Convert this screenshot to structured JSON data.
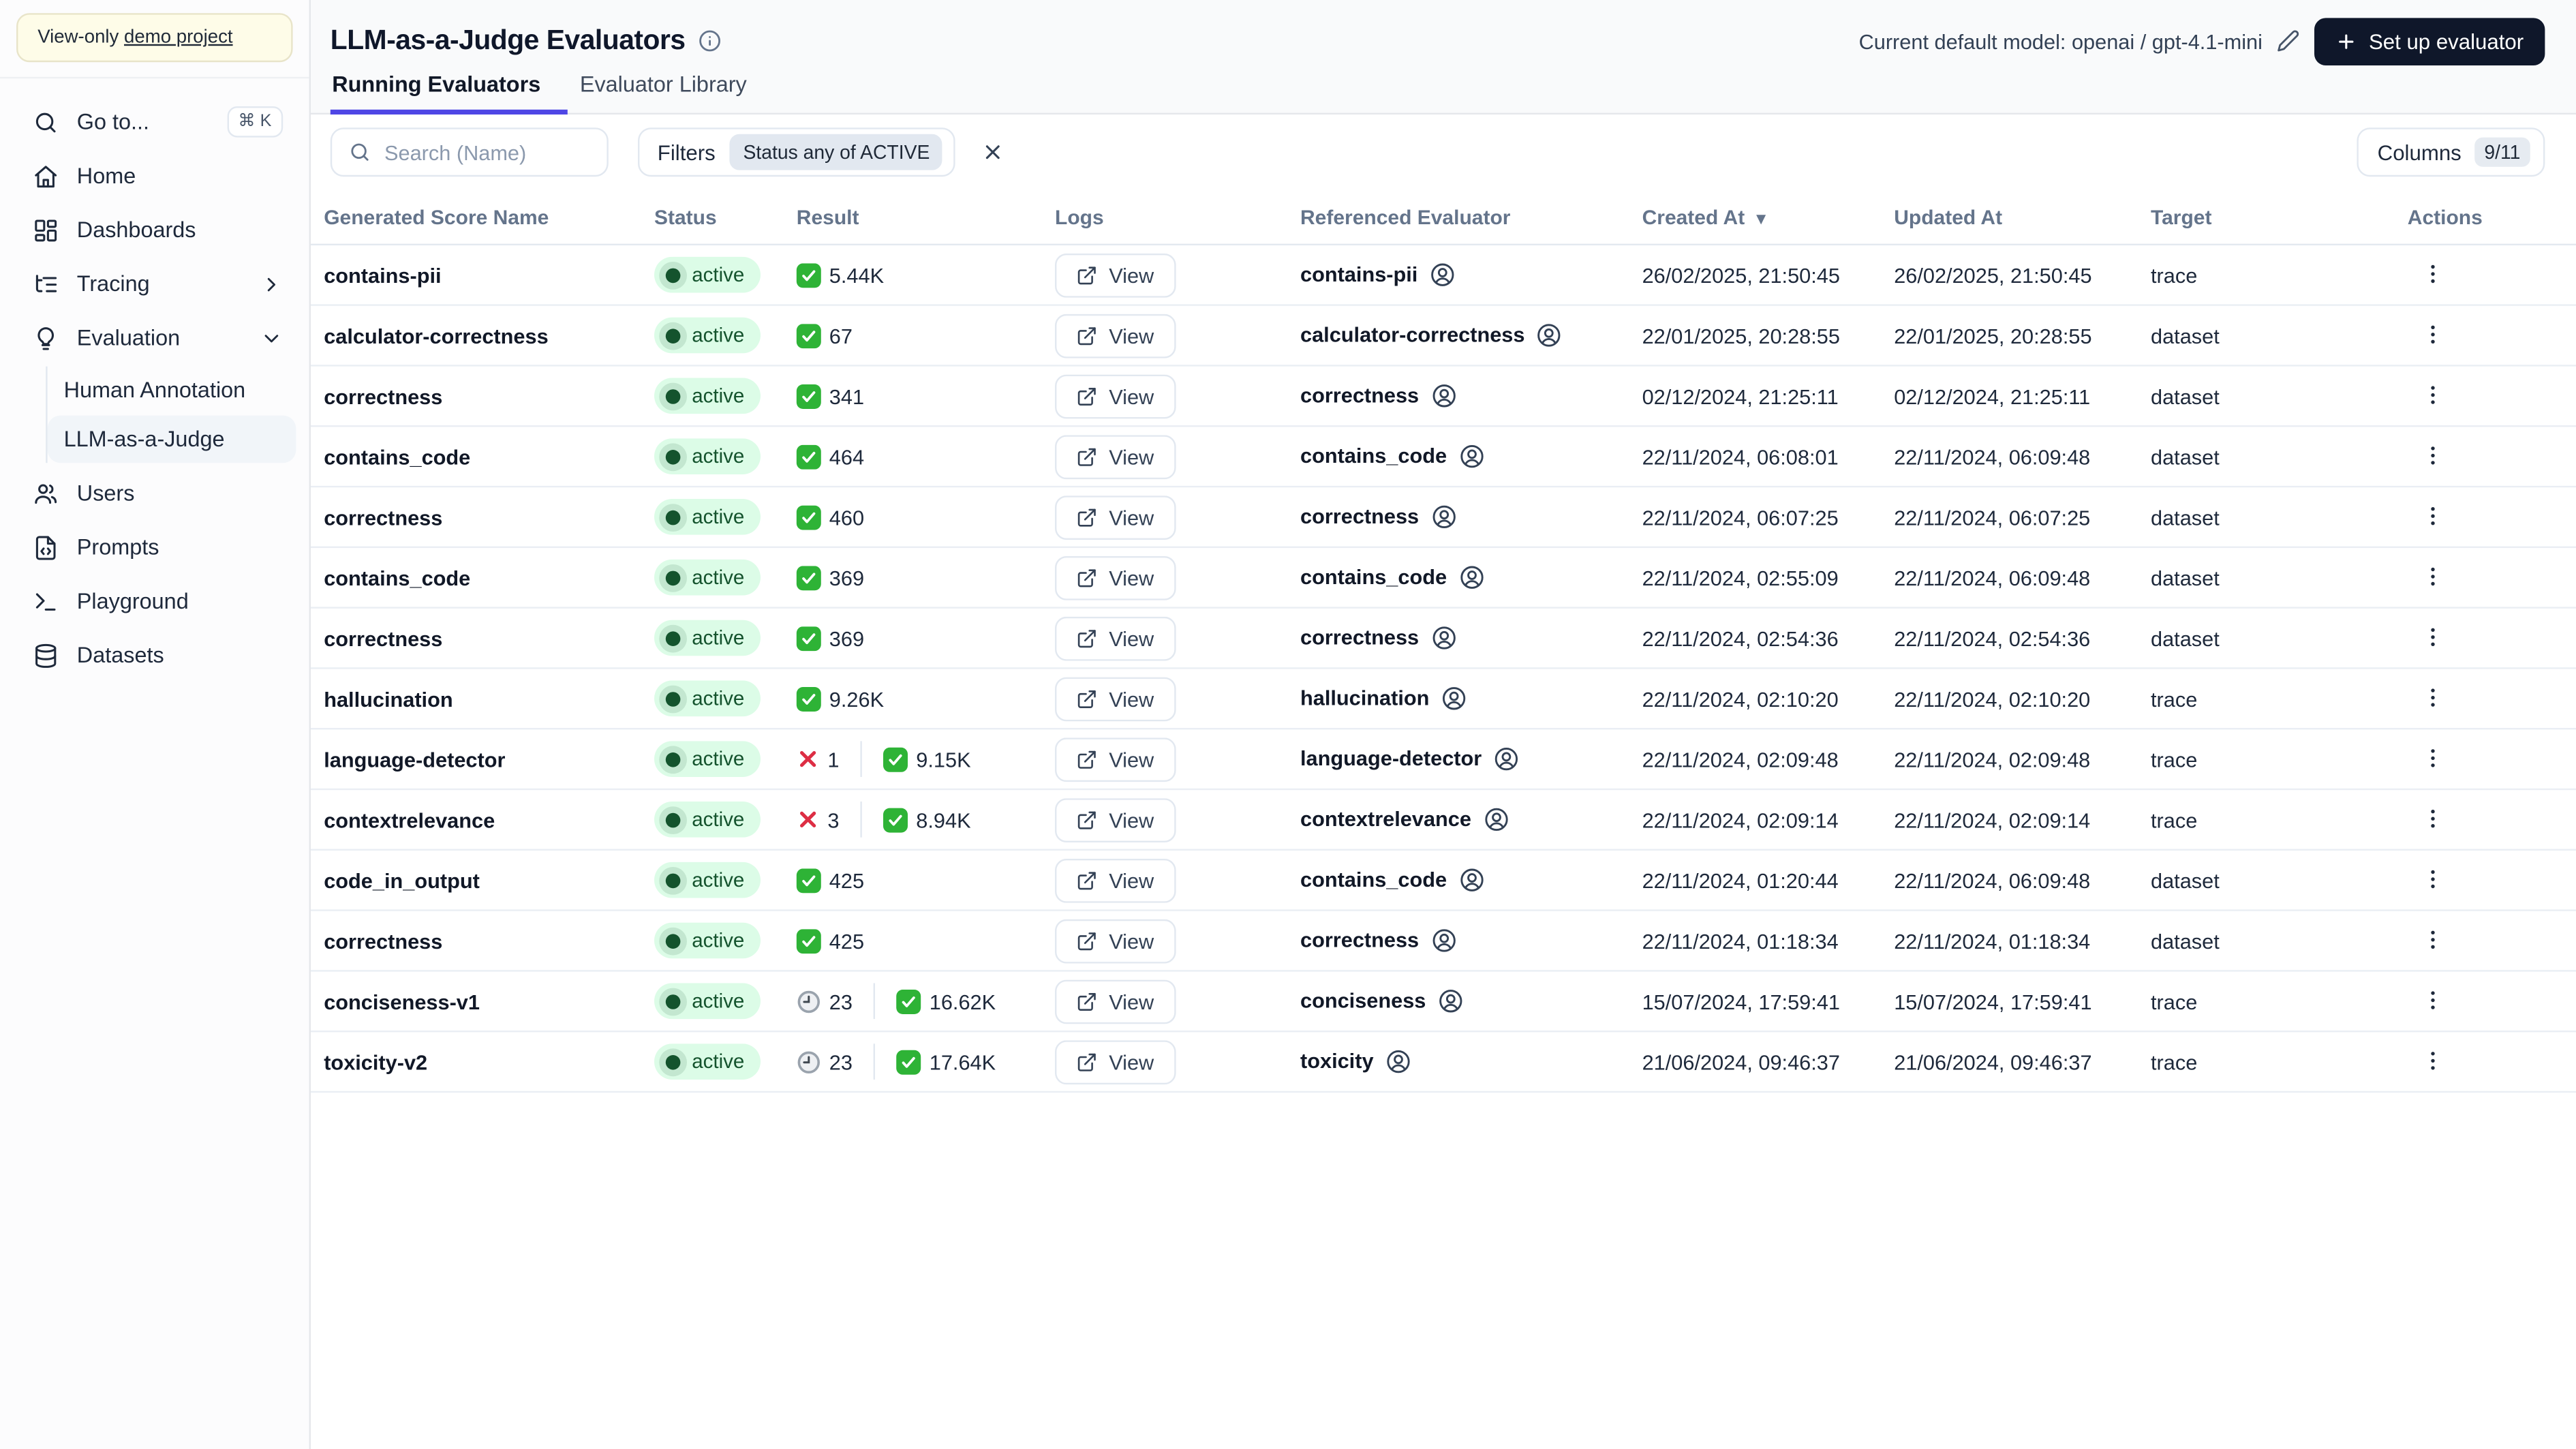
{
  "sidebar": {
    "banner_prefix": "View-only ",
    "banner_link": "demo project",
    "goto": {
      "label": "Go to...",
      "shortcut": "⌘ K"
    },
    "nav": [
      {
        "label": "Home",
        "icon": "home-icon"
      },
      {
        "label": "Dashboards",
        "icon": "dashboards-icon"
      },
      {
        "label": "Tracing",
        "icon": "tracing-icon",
        "chevron": "right"
      },
      {
        "label": "Evaluation",
        "icon": "evaluation-icon",
        "chevron": "down",
        "children": [
          {
            "label": "Human Annotation",
            "active": false
          },
          {
            "label": "LLM-as-a-Judge",
            "active": true
          }
        ]
      },
      {
        "label": "Users",
        "icon": "users-icon"
      },
      {
        "label": "Prompts",
        "icon": "prompts-icon"
      },
      {
        "label": "Playground",
        "icon": "playground-icon"
      },
      {
        "label": "Datasets",
        "icon": "datasets-icon"
      }
    ]
  },
  "header": {
    "title": "LLM-as-a-Judge Evaluators",
    "model_label": "Current default model: openai / gpt-4.1-mini",
    "setup_button": "Set up evaluator"
  },
  "tabs": [
    {
      "label": "Running Evaluators",
      "active": true
    },
    {
      "label": "Evaluator Library",
      "active": false
    }
  ],
  "toolbar": {
    "search_placeholder": "Search (Name)",
    "filters_label": "Filters",
    "filter_chip": "Status any of ACTIVE",
    "columns_label": "Columns",
    "columns_count": "9/11"
  },
  "table": {
    "columns": [
      "Generated Score Name",
      "Status",
      "Result",
      "Logs",
      "Referenced Evaluator",
      "Created At",
      "Updated At",
      "Target",
      "Actions"
    ],
    "sort": {
      "column": "Created At",
      "direction": "desc"
    },
    "logs_label": "View",
    "rows": [
      {
        "name": "contains-pii",
        "status": "active",
        "result": {
          "success": "5.44K"
        },
        "evaluator": "contains-pii",
        "created": "26/02/2025, 21:50:45",
        "updated": "26/02/2025, 21:50:45",
        "target": "trace"
      },
      {
        "name": "calculator-correctness",
        "status": "active",
        "result": {
          "success": "67"
        },
        "evaluator": "calculator-correctness",
        "created": "22/01/2025, 20:28:55",
        "updated": "22/01/2025, 20:28:55",
        "target": "dataset"
      },
      {
        "name": "correctness",
        "status": "active",
        "result": {
          "success": "341"
        },
        "evaluator": "correctness",
        "created": "02/12/2024, 21:25:11",
        "updated": "02/12/2024, 21:25:11",
        "target": "dataset"
      },
      {
        "name": "contains_code",
        "status": "active",
        "result": {
          "success": "464"
        },
        "evaluator": "contains_code",
        "created": "22/11/2024, 06:08:01",
        "updated": "22/11/2024, 06:09:48",
        "target": "dataset"
      },
      {
        "name": "correctness",
        "status": "active",
        "result": {
          "success": "460"
        },
        "evaluator": "correctness",
        "created": "22/11/2024, 06:07:25",
        "updated": "22/11/2024, 06:07:25",
        "target": "dataset"
      },
      {
        "name": "contains_code",
        "status": "active",
        "result": {
          "success": "369"
        },
        "evaluator": "contains_code",
        "created": "22/11/2024, 02:55:09",
        "updated": "22/11/2024, 06:09:48",
        "target": "dataset"
      },
      {
        "name": "correctness",
        "status": "active",
        "result": {
          "success": "369"
        },
        "evaluator": "correctness",
        "created": "22/11/2024, 02:54:36",
        "updated": "22/11/2024, 02:54:36",
        "target": "dataset"
      },
      {
        "name": "hallucination",
        "status": "active",
        "result": {
          "success": "9.26K"
        },
        "evaluator": "hallucination",
        "created": "22/11/2024, 02:10:20",
        "updated": "22/11/2024, 02:10:20",
        "target": "trace"
      },
      {
        "name": "language-detector",
        "status": "active",
        "result": {
          "error": "1",
          "success": "9.15K"
        },
        "evaluator": "language-detector",
        "created": "22/11/2024, 02:09:48",
        "updated": "22/11/2024, 02:09:48",
        "target": "trace"
      },
      {
        "name": "contextrelevance",
        "status": "active",
        "result": {
          "error": "3",
          "success": "8.94K"
        },
        "evaluator": "contextrelevance",
        "created": "22/11/2024, 02:09:14",
        "updated": "22/11/2024, 02:09:14",
        "target": "trace"
      },
      {
        "name": "code_in_output",
        "status": "active",
        "result": {
          "success": "425"
        },
        "evaluator": "contains_code",
        "created": "22/11/2024, 01:20:44",
        "updated": "22/11/2024, 06:09:48",
        "target": "dataset"
      },
      {
        "name": "correctness",
        "status": "active",
        "result": {
          "success": "425"
        },
        "evaluator": "correctness",
        "created": "22/11/2024, 01:18:34",
        "updated": "22/11/2024, 01:18:34",
        "target": "dataset"
      },
      {
        "name": "conciseness-v1",
        "status": "active",
        "result": {
          "pending": "23",
          "success": "16.62K"
        },
        "evaluator": "conciseness",
        "created": "15/07/2024, 17:59:41",
        "updated": "15/07/2024, 17:59:41",
        "target": "trace"
      },
      {
        "name": "toxicity-v2",
        "status": "active",
        "result": {
          "pending": "23",
          "success": "17.64K"
        },
        "evaluator": "toxicity",
        "created": "21/06/2024, 09:46:37",
        "updated": "21/06/2024, 09:46:37",
        "target": "trace"
      }
    ]
  },
  "colors": {
    "accent_tab": "#4f46e5",
    "active_badge_bg": "#dcfce7",
    "active_badge_text": "#14532d",
    "success_green": "#2eb336",
    "error_red": "#dd2e44",
    "dark_button": "#0f172a",
    "banner_bg": "#fefce8"
  }
}
